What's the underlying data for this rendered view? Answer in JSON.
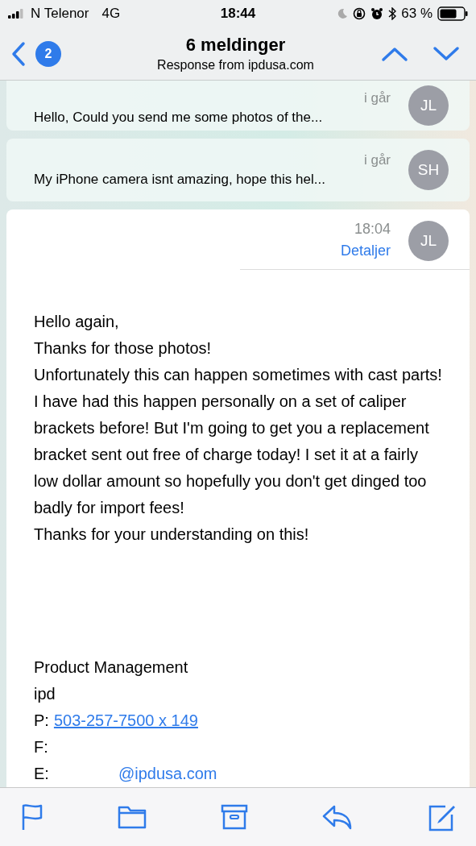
{
  "status_bar": {
    "carrier": "N Telenor",
    "network": "4G",
    "time": "18:44",
    "battery": "63 %"
  },
  "nav": {
    "back_badge": "2",
    "title": "6 meldinger",
    "subtitle": "Response from ipdusa.com"
  },
  "messages": [
    {
      "kind": "collapsed",
      "time": "i går",
      "preview": "Hello, Could you send me some photos of the...",
      "initials": "JL"
    },
    {
      "kind": "collapsed",
      "time": "i går",
      "preview": "My iPhone camera isnt amazing, hope this hel...",
      "initials": "SH"
    },
    {
      "kind": "expanded",
      "time": "18:04",
      "details": "Detaljer",
      "initials": "JL",
      "body": [
        "Hello again,",
        "Thanks for those photos!",
        "Unfortunately this can happen sometimes with cast parts! I have had this happen personally on a set of caliper brackets before! But I'm going to get you a replacement bracket sent out free of charge today! I set it at a fairly low dollar amount so hopefully you don't get dinged too badly for import fees!",
        "Thanks for your understanding on this!"
      ],
      "signature": [
        {
          "label": "Product Management"
        },
        {
          "label": "ipd"
        },
        {
          "label": "P:",
          "link": "503-257-7500 x 149"
        },
        {
          "label": "F:"
        },
        {
          "label": "E:",
          "link": "@ipdusa.com"
        }
      ]
    }
  ]
}
